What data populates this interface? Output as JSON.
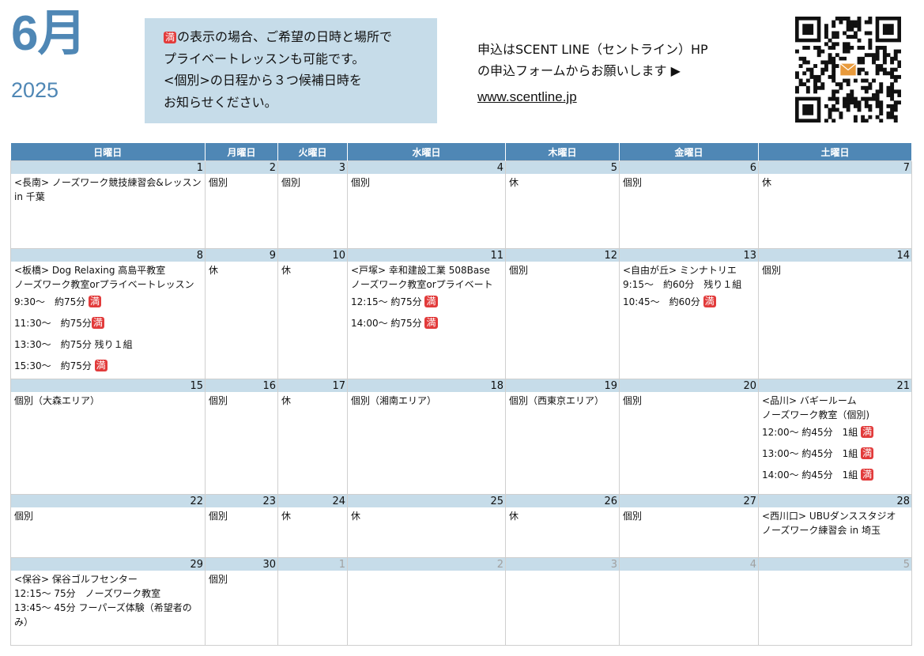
{
  "header": {
    "month": "6月",
    "year": "2025",
    "notice_lines": [
      "の表示の場合、ご希望の日時と場所で",
      "プライベートレッスンも可能です。",
      "<個別>の日程から３つ候補日時を",
      "お知らせください。"
    ],
    "full_mark": "満",
    "apply_lines": [
      "申込はSCENT LINE（セントライン）HP",
      "の申込フォームからお願いします ▶"
    ],
    "url": "www.scentline.jp",
    "qr_label": "qr-code",
    "accent": "#4f87b5",
    "light": "#c6dce9",
    "badge_color": "#e23b3b"
  },
  "weekdays": [
    "日曜日",
    "月曜日",
    "火曜日",
    "水曜日",
    "木曜日",
    "金曜日",
    "土曜日"
  ],
  "weeks": [
    [
      {
        "day": "1",
        "lines": [
          "<長南> ノーズワーク競技練習会&レッスン in 千葉"
        ]
      },
      {
        "day": "2",
        "lines": [
          "個別"
        ]
      },
      {
        "day": "3",
        "lines": [
          "個別"
        ]
      },
      {
        "day": "4",
        "lines": [
          "個別"
        ]
      },
      {
        "day": "5",
        "lines": [
          "休"
        ]
      },
      {
        "day": "6",
        "lines": [
          "個別"
        ]
      },
      {
        "day": "7",
        "lines": [
          "休"
        ]
      }
    ],
    [
      {
        "day": "8",
        "lines": [
          "<板橋> Dog Relaxing  高島平教室",
          "ノーズワーク教室orプライベートレッスン",
          "  9:30～　約75分 [満]",
          "11:30～　約75分[満]",
          "13:30～　約75分  残り１組",
          "15:30～　約75分 [満]"
        ]
      },
      {
        "day": "9",
        "lines": [
          "休"
        ]
      },
      {
        "day": "10",
        "lines": [
          "休"
        ]
      },
      {
        "day": "11",
        "lines": [
          "<戸塚> 幸和建設工業 508Base",
          "ノーズワーク教室orプライベート",
          "12:15～ 約75分 [満]",
          "14:00～ 約75分 [満]"
        ]
      },
      {
        "day": "12",
        "lines": [
          "個別"
        ]
      },
      {
        "day": "13",
        "lines": [
          "<自由が丘>  ミンナトリエ",
          "9:15～　約60分　残り１組",
          "10:45～　約60分 [満]"
        ]
      },
      {
        "day": "14",
        "lines": [
          "個別"
        ]
      }
    ],
    [
      {
        "day": "15",
        "lines": [
          "個別（大森エリア）"
        ]
      },
      {
        "day": "16",
        "lines": [
          "個別"
        ]
      },
      {
        "day": "17",
        "lines": [
          "休"
        ]
      },
      {
        "day": "18",
        "lines": [
          "個別（湘南エリア）"
        ]
      },
      {
        "day": "19",
        "lines": [
          "個別（西東京エリア）"
        ]
      },
      {
        "day": "20",
        "lines": [
          "個別"
        ]
      },
      {
        "day": "21",
        "lines": [
          "<品川> バギールーム",
          "ノーズワーク教室（個別)",
          "12:00～ 約45分　1組 [満]",
          "13:00～ 約45分　1組 [満]",
          "14:00～ 約45分　1組 [満]"
        ]
      }
    ],
    [
      {
        "day": "22",
        "lines": [
          "個別"
        ]
      },
      {
        "day": "23",
        "lines": [
          "個別"
        ]
      },
      {
        "day": "24",
        "lines": [
          "休"
        ]
      },
      {
        "day": "25",
        "lines": [
          "休"
        ]
      },
      {
        "day": "26",
        "lines": [
          "休"
        ]
      },
      {
        "day": "27",
        "lines": [
          "個別"
        ]
      },
      {
        "day": "28",
        "lines": [
          "<西川口> UBUダンススタジオ",
          "ノーズワーク練習会  in 埼玉"
        ]
      }
    ],
    [
      {
        "day": "29",
        "lines": [
          "<保谷> 保谷ゴルフセンター",
          "12:15～ 75分　ノーズワーク教室",
          "13:45～  45分  フーパーズ体験（希望者のみ）"
        ]
      },
      {
        "day": "30",
        "lines": [
          "個別"
        ]
      },
      {
        "day": "1",
        "off": true,
        "lines": []
      },
      {
        "day": "2",
        "off": true,
        "lines": []
      },
      {
        "day": "3",
        "off": true,
        "lines": []
      },
      {
        "day": "4",
        "off": true,
        "lines": []
      },
      {
        "day": "5",
        "off": true,
        "lines": []
      }
    ]
  ]
}
